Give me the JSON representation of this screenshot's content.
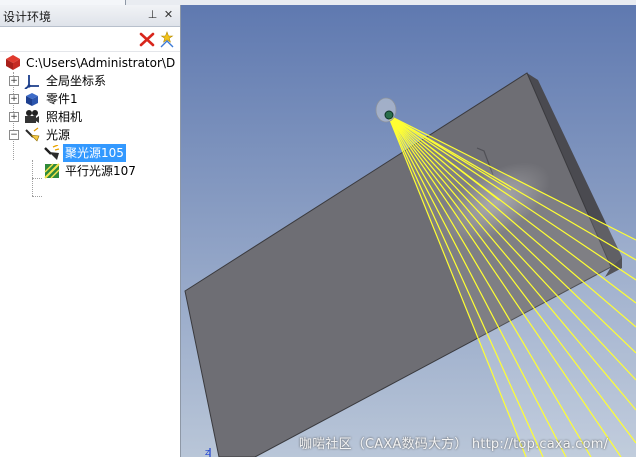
{
  "panel": {
    "title": "设计环境",
    "pin_glyph": "⊥",
    "close_glyph": "✕"
  },
  "tree": {
    "root": "C:\\Users\\Administrator\\D",
    "items": [
      {
        "label": "全局坐标系",
        "expander": "+"
      },
      {
        "label": "零件1",
        "expander": "+"
      },
      {
        "label": "照相机",
        "expander": "+"
      },
      {
        "label": "光源",
        "expander": "−",
        "children": [
          {
            "label": "聚光源105",
            "selected": true
          },
          {
            "label": "平行光源107"
          }
        ]
      }
    ]
  },
  "viewport": {
    "watermark": "咖啱社区（CAXA数码大方） http://top.caxa.com/",
    "axis_label": "Z"
  },
  "colors": {
    "sky_top": "#5f79b0",
    "sky_bottom": "#b9c6d8",
    "plate": "#6e6e74",
    "light_cone": "#ffff33",
    "selection": "#3399ff"
  },
  "icons": {
    "clear": "red-x-icon",
    "filter": "light-filter-icon"
  }
}
